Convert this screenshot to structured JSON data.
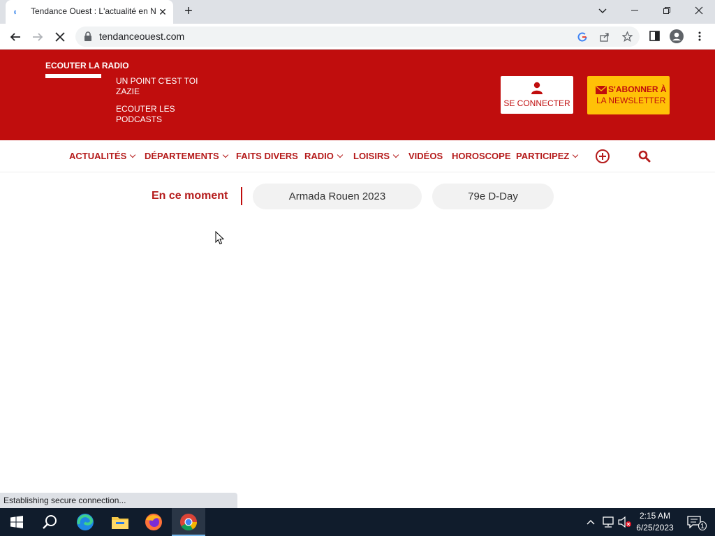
{
  "browser": {
    "tab_title": "Tendance Ouest : L'actualité en N",
    "url": "tendanceouest.com",
    "status_text": "Establishing secure connection..."
  },
  "header": {
    "radio_title": "ECOUTER LA RADIO",
    "radio_link1": "UN POINT C'EST TOI ZAZIE",
    "radio_link2": "ECOUTER LES PODCASTS",
    "connect_label": "SE CONNECTER",
    "newsletter_line1": "S'ABONNER À",
    "newsletter_line2": "LA NEWSLETTER"
  },
  "nav": {
    "items": [
      {
        "label": "ACTUALITÉS"
      },
      {
        "label": "DÉPARTEMENTS"
      },
      {
        "label": "FAITS DIVERS"
      },
      {
        "label": "RADIO"
      },
      {
        "label": "LOISIRS"
      },
      {
        "label": "VIDÉOS"
      },
      {
        "label": "HOROSCOPE"
      },
      {
        "label": "PARTICIPEZ"
      }
    ]
  },
  "moment": {
    "label": "En ce moment",
    "pills": [
      "Armada Rouen 2023",
      "79e D-Day"
    ]
  },
  "taskbar": {
    "time": "2:15 AM",
    "date": "6/25/2023",
    "notification_count": "1"
  },
  "colors": {
    "brand_red": "#c00d0d",
    "nav_red": "#b51b1b",
    "newsletter_yellow": "#ffc107",
    "taskbar": "#101c2c"
  }
}
